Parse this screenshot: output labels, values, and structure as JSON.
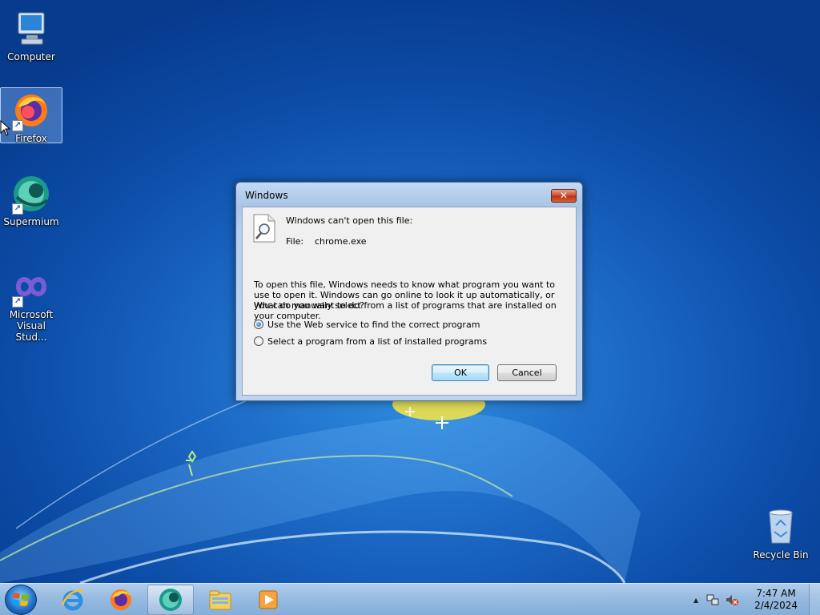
{
  "desktop": {
    "icons": [
      {
        "label": "Computer"
      },
      {
        "label": "Firefox"
      },
      {
        "label": "Supermium"
      },
      {
        "label": "Microsoft Visual Stud..."
      },
      {
        "label": "Recycle Bin"
      }
    ]
  },
  "dialog": {
    "title": "Windows",
    "close_label": "✕",
    "heading": "Windows can't open this file:",
    "file_label": "File:",
    "file_name": "chrome.exe",
    "description": "To open this file, Windows needs to know what program you want to use to open it. Windows can go online to look it up automatically, or you can manually select from a list of programs that are installed on your computer.",
    "question": "What do you want to do?",
    "options": [
      {
        "label": "Use the Web service to find the correct program",
        "checked": true
      },
      {
        "label": "Select a program from a list of installed programs",
        "checked": false
      }
    ],
    "ok_label": "OK",
    "cancel_label": "Cancel"
  },
  "taskbar": {
    "pinned": [
      {
        "name": "internet-explorer-icon"
      },
      {
        "name": "firefox-icon"
      },
      {
        "name": "supermium-icon",
        "active": true
      },
      {
        "name": "file-explorer-icon"
      },
      {
        "name": "media-player-icon"
      }
    ],
    "tray": {
      "chevron": "▲",
      "time": "7:47 AM",
      "date": "2/4/2024"
    }
  },
  "colors": {
    "desktop_bg": "#1d6cc8",
    "dialog_frame": "#b8cfec",
    "close_button": "#cc4a30",
    "taskbar": "#a0c3e4"
  }
}
